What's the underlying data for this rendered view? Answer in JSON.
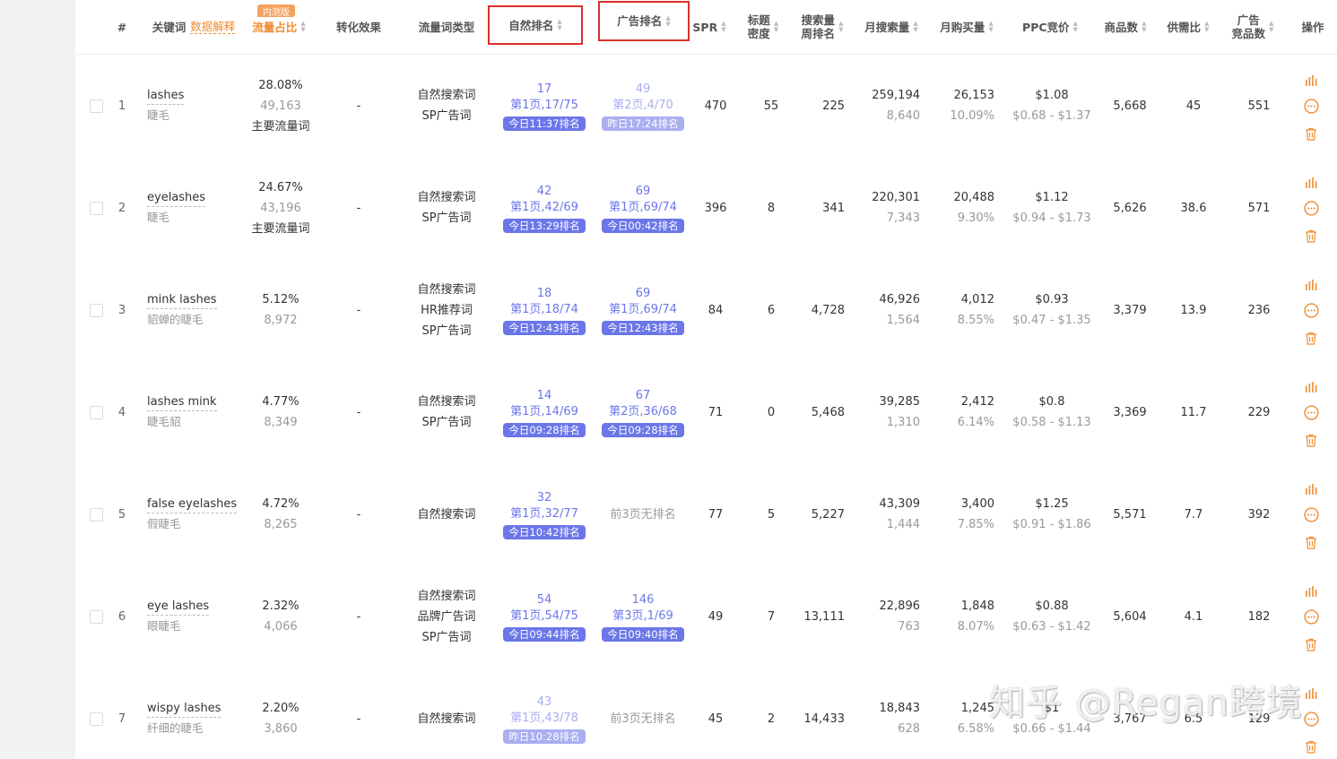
{
  "header": {
    "index": "#",
    "keyword": "关键词",
    "data_explain": "数据解释",
    "beta_badge": "内测版",
    "traffic_share": "流量占比",
    "conversion": "转化效果",
    "traffic_type": "流量词类型",
    "organic_rank": "自然排名",
    "ad_rank": "广告排名",
    "spr": "SPR",
    "title_density_1": "标题",
    "title_density_2": "密度",
    "search_rank_1": "搜索量",
    "search_rank_2": "周排名",
    "monthly_search": "月搜索量",
    "monthly_buy": "月购买量",
    "ppc": "PPC竞价",
    "products": "商品数",
    "supply_demand": "供需比",
    "ad_comp_1": "广告",
    "ad_comp_2": "竞品数",
    "actions": "操作"
  },
  "rows": [
    {
      "idx": "1",
      "kw": "lashes",
      "kw_cn": "睫毛",
      "share": "28.08%",
      "share_n": "49,163",
      "share_tag": "主要流量词",
      "conv": "-",
      "types": [
        "自然搜索词",
        "SP广告词"
      ],
      "org": {
        "num": "17",
        "page": "第1页,17/75",
        "tag": "今日11:37排名",
        "faded": false
      },
      "ad": {
        "num": "49",
        "page": "第2页,4/70",
        "tag": "昨日17:24排名",
        "faded": true,
        "none": ""
      },
      "spr": "470",
      "density": "55",
      "srank": "225",
      "msearch": "259,194",
      "msearch_d": "8,640",
      "mbuy": "26,153",
      "mbuy_pct": "10.09%",
      "ppc": "$1.08",
      "ppc_range": "$0.68 - $1.37",
      "products": "5,668",
      "sd": "45",
      "adc": "551"
    },
    {
      "idx": "2",
      "kw": "eyelashes",
      "kw_cn": "睫毛",
      "share": "24.67%",
      "share_n": "43,196",
      "share_tag": "主要流量词",
      "conv": "-",
      "types": [
        "自然搜索词",
        "SP广告词"
      ],
      "org": {
        "num": "42",
        "page": "第1页,42/69",
        "tag": "今日13:29排名",
        "faded": false
      },
      "ad": {
        "num": "69",
        "page": "第1页,69/74",
        "tag": "今日00:42排名",
        "faded": false,
        "none": ""
      },
      "spr": "396",
      "density": "8",
      "srank": "341",
      "msearch": "220,301",
      "msearch_d": "7,343",
      "mbuy": "20,488",
      "mbuy_pct": "9.30%",
      "ppc": "$1.12",
      "ppc_range": "$0.94 - $1.73",
      "products": "5,626",
      "sd": "38.6",
      "adc": "571"
    },
    {
      "idx": "3",
      "kw": "mink lashes",
      "kw_cn": "貂蝉的睫毛",
      "share": "5.12%",
      "share_n": "8,972",
      "share_tag": "",
      "conv": "-",
      "types": [
        "自然搜索词",
        "HR推荐词",
        "SP广告词"
      ],
      "org": {
        "num": "18",
        "page": "第1页,18/74",
        "tag": "今日12:43排名",
        "faded": false
      },
      "ad": {
        "num": "69",
        "page": "第1页,69/74",
        "tag": "今日12:43排名",
        "faded": false,
        "none": ""
      },
      "spr": "84",
      "density": "6",
      "srank": "4,728",
      "msearch": "46,926",
      "msearch_d": "1,564",
      "mbuy": "4,012",
      "mbuy_pct": "8.55%",
      "ppc": "$0.93",
      "ppc_range": "$0.47 - $1.35",
      "products": "3,379",
      "sd": "13.9",
      "adc": "236"
    },
    {
      "idx": "4",
      "kw": "lashes mink",
      "kw_cn": "睫毛貂",
      "share": "4.77%",
      "share_n": "8,349",
      "share_tag": "",
      "conv": "-",
      "types": [
        "自然搜索词",
        "SP广告词"
      ],
      "org": {
        "num": "14",
        "page": "第1页,14/69",
        "tag": "今日09:28排名",
        "faded": false
      },
      "ad": {
        "num": "67",
        "page": "第2页,36/68",
        "tag": "今日09:28排名",
        "faded": false,
        "none": ""
      },
      "spr": "71",
      "density": "0",
      "srank": "5,468",
      "msearch": "39,285",
      "msearch_d": "1,310",
      "mbuy": "2,412",
      "mbuy_pct": "6.14%",
      "ppc": "$0.8",
      "ppc_range": "$0.58 - $1.13",
      "products": "3,369",
      "sd": "11.7",
      "adc": "229"
    },
    {
      "idx": "5",
      "kw": "false eyelashes",
      "kw_cn": "假睫毛",
      "share": "4.72%",
      "share_n": "8,265",
      "share_tag": "",
      "conv": "-",
      "types": [
        "自然搜索词"
      ],
      "org": {
        "num": "32",
        "page": "第1页,32/77",
        "tag": "今日10:42排名",
        "faded": false
      },
      "ad": {
        "num": "",
        "page": "",
        "tag": "",
        "faded": false,
        "none": "前3页无排名"
      },
      "spr": "77",
      "density": "5",
      "srank": "5,227",
      "msearch": "43,309",
      "msearch_d": "1,444",
      "mbuy": "3,400",
      "mbuy_pct": "7.85%",
      "ppc": "$1.25",
      "ppc_range": "$0.91 - $1.86",
      "products": "5,571",
      "sd": "7.7",
      "adc": "392"
    },
    {
      "idx": "6",
      "kw": "eye lashes",
      "kw_cn": "眼睫毛",
      "share": "2.32%",
      "share_n": "4,066",
      "share_tag": "",
      "conv": "-",
      "types": [
        "自然搜索词",
        "品牌广告词",
        "SP广告词"
      ],
      "org": {
        "num": "54",
        "page": "第1页,54/75",
        "tag": "今日09:44排名",
        "faded": false
      },
      "ad": {
        "num": "146",
        "page": "第3页,1/69",
        "tag": "今日09:40排名",
        "faded": false,
        "none": ""
      },
      "spr": "49",
      "density": "7",
      "srank": "13,111",
      "msearch": "22,896",
      "msearch_d": "763",
      "mbuy": "1,848",
      "mbuy_pct": "8.07%",
      "ppc": "$0.88",
      "ppc_range": "$0.63 - $1.42",
      "products": "5,604",
      "sd": "4.1",
      "adc": "182"
    },
    {
      "idx": "7",
      "kw": "wispy lashes",
      "kw_cn": "纤细的睫毛",
      "share": "2.20%",
      "share_n": "3,860",
      "share_tag": "",
      "conv": "-",
      "types": [
        "自然搜索词"
      ],
      "org": {
        "num": "43",
        "page": "第1页,43/78",
        "tag": "昨日10:28排名",
        "faded": true
      },
      "ad": {
        "num": "",
        "page": "",
        "tag": "",
        "faded": false,
        "none": "前3页无排名"
      },
      "spr": "45",
      "density": "2",
      "srank": "14,433",
      "msearch": "18,843",
      "msearch_d": "628",
      "mbuy": "1,245",
      "mbuy_pct": "6.58%",
      "ppc": "$1",
      "ppc_range": "$0.66 - $1.44",
      "products": "3,767",
      "sd": "6.5",
      "adc": "129"
    }
  ],
  "icons": {
    "chart": "bar-chart-icon",
    "more": "more-icon",
    "delete": "trash-icon"
  },
  "colors": {
    "accent": "#6b76e8",
    "accent_faded": "#a8aef0",
    "orange": "#f08c2e",
    "danger": "#f08c2e",
    "highlight_border": "#d9312b"
  },
  "watermark": "知乎 @Regan跨境"
}
